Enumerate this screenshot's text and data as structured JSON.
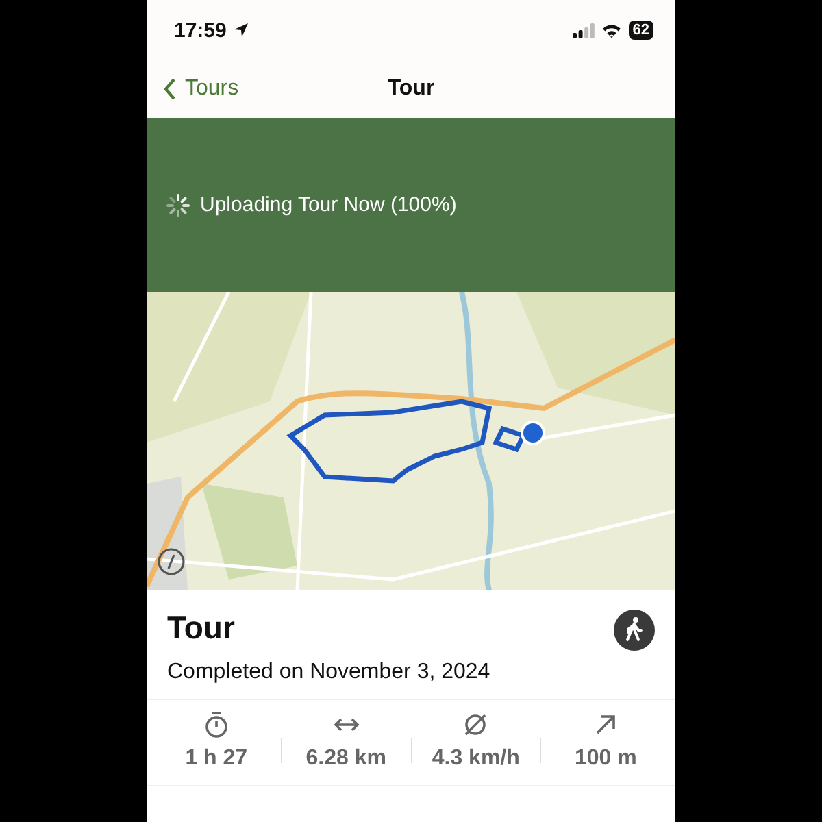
{
  "status_bar": {
    "time": "17:59",
    "battery": "62"
  },
  "nav": {
    "back": "Tours",
    "title": "Tour"
  },
  "banner": {
    "text": "Uploading Tour Now (100%)"
  },
  "tour": {
    "title": "Tour",
    "subtitle": "Completed on November 3, 2024"
  },
  "stats": [
    {
      "kind": "duration",
      "value": "1 h 27"
    },
    {
      "kind": "distance",
      "value": "6.28 km"
    },
    {
      "kind": "speed",
      "value": "4.3 km/h"
    },
    {
      "kind": "elevation",
      "value": "100 m"
    }
  ]
}
